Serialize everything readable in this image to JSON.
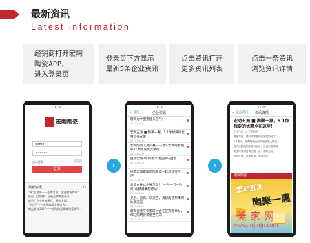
{
  "header": {
    "title": "最新资讯",
    "subtitle": "Latest information",
    "accent_color": "#c0262d"
  },
  "steps": [
    {
      "text": "经销商打开宏陶\n陶瓷APP，\n进入登录页"
    },
    {
      "text": "登录页下方显示\n最新5条企业资讯"
    },
    {
      "text": "点击资讯打开\n更多资讯列表"
    },
    {
      "text": "点击一条资讯\n浏览资讯详情"
    }
  ],
  "phones": {
    "login": {
      "statusbar": "16:28",
      "logo_text": "宏陶陶瓷",
      "username_value": "wimo",
      "remember_label": "自动登录",
      "login_button": "登录",
      "news_title": "最新资讯",
      "refresh_icon": "refresh-icon",
      "news_lines": [
        "\"黄\"生龙年——宏陶名家厂家逆转再传承\"",
        "恒泰门店销售：出新品牌陶瓷共享...",
        "前沿！企业性能更优，云南发展...",
        "\"2017\"——宏陶陶瓷全新发布...",
        "新品发布2017——宏陶陶瓷高端陶瓷系列..."
      ]
    },
    "list": {
      "statusbar": "16:28",
      "back": "< 首页",
      "title": "企业资讯",
      "items": [
        {
          "title": "宏陶为中国瓷迷长志气!",
          "date": "2017-04-06"
        },
        {
          "title": "宏陶五洲 ■ 陶聚一惠，5.1你想要的优惠全在这里！",
          "date": "2017-04-06"
        },
        {
          "title": "宏陶陶瓷丨真实赛——意义宏陶陶瓷组织21周年庆典大举行",
          "date": "2017-04-06"
        },
        {
          "title": "盘点宏陶2月陶瓷市场回顾与盘点",
          "date": "2017-04-06"
        },
        {
          "title": "招聘宏陶家居宏陶陶瓷一起忽悠天下吧！",
          "date": "2017-04-06"
        },
        {
          "title": "奥凤古往以业导活动！\"一人一勺一片采\"收获满满的感动！",
          "date": "2017-04-06"
        },
        {
          "title": "党冠、瓷商、玩泥巴，清新房子原来阿达就这些",
          "date": "2017-04-06"
        },
        {
          "title": "宏陶瓷重庆专家研讨会在宜宾圆举办，细分照明要求重至方向",
          "date": "2017-04-06"
        }
      ]
    },
    "detail": {
      "statusbar": "16:28",
      "back": "< 企业资讯",
      "title": "资讯详情",
      "article_title": "宏动五洲 ■ 陶聚一惠，5.1你想要的优惠全在这里！",
      "meta": "2017-04-06  宏陶陶瓷",
      "text_lines": [
        "春暖花开，是时候享受你的家居新品了！",
        "5.1期间，宏陶陶瓷全线产品优惠大放送，",
        "各大经销商同步参与活动，欢迎到店体验",
        "更多详情请咨询当地门店，限时活动，",
        "先到先得，优惠多多，不容错过！"
      ],
      "banner_brand": "宏陶陶瓷",
      "banner_big1": "宏动五洲",
      "banner_big2": "陶聚一惠"
    }
  },
  "arrows": {
    "icon": "chevron-right-icon",
    "glyph": "›",
    "color": "#2aa7de"
  },
  "watermark": {
    "cn": "美家网",
    "url": "www.mjmjn.com"
  }
}
